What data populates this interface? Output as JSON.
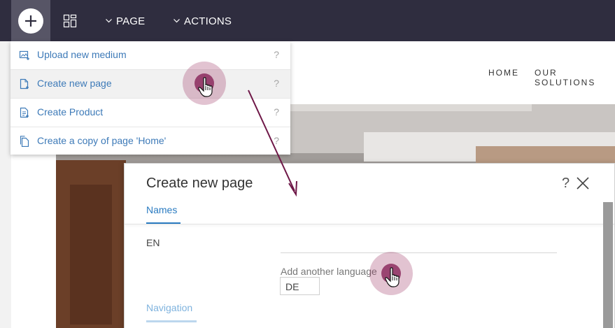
{
  "toolbar": {
    "add_icon": "plus-icon",
    "grid_icon": "grid-icon",
    "menus": [
      {
        "label": "PAGE",
        "icon": "chevron-down-icon"
      },
      {
        "label": "ACTIONS",
        "icon": "chevron-down-icon"
      }
    ],
    "colors": {
      "background": "#2f2d3f",
      "active": "#575566"
    }
  },
  "site": {
    "nav": [
      "HOME",
      "OUR SOLUTIONS"
    ]
  },
  "dropdown": {
    "items": [
      {
        "label": "Upload new medium",
        "help": "?",
        "icon": "upload-image-icon"
      },
      {
        "label": "Create new page",
        "help": "?",
        "icon": "new-page-icon"
      },
      {
        "label": "Create Product",
        "help": "?",
        "icon": "product-page-icon"
      },
      {
        "label": "Create a copy of page 'Home'",
        "help": "?",
        "icon": "copy-page-icon"
      }
    ],
    "link_color": "#3d7ab8"
  },
  "dialog": {
    "title": "Create new page",
    "help": "?",
    "close_icon": "close-icon",
    "tabs": [
      "Names",
      "Navigation"
    ],
    "fields": {
      "en_label": "EN",
      "en_value": "",
      "add_language_label": "Add another language",
      "language_option": "DE"
    },
    "accent": "#2a7bc1"
  },
  "annotations": {
    "click_marker_color": "#96285a",
    "pointer_icon": "hand-pointer-icon",
    "arrow_icon": "arrow-icon"
  }
}
